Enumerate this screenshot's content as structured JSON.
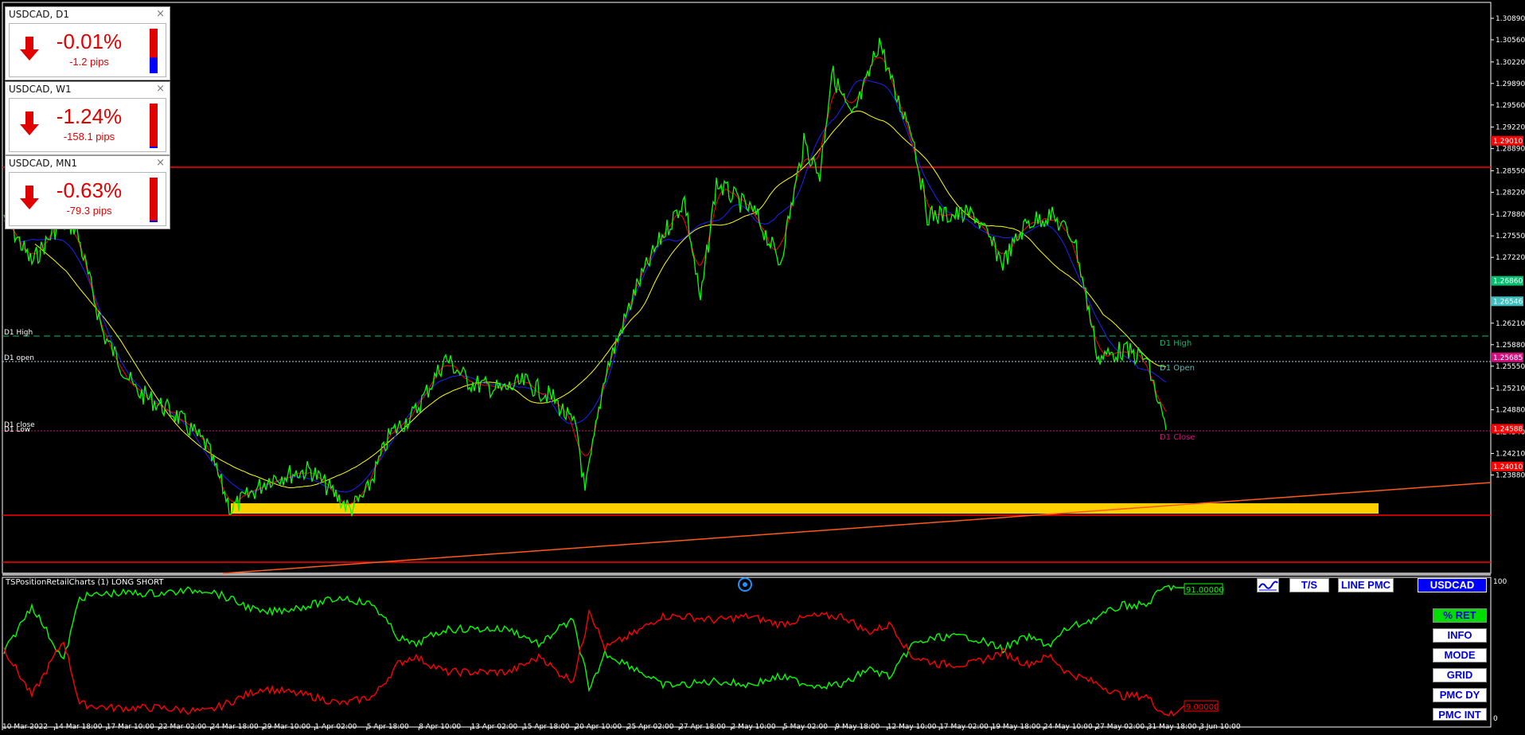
{
  "symbol_panels": [
    {
      "title": "USDCAD, D1",
      "percent": "-0.01%",
      "pips": "-1.2 pips",
      "direction": "down",
      "level": 0.35,
      "level_color": "#0000ff"
    },
    {
      "title": "USDCAD, W1",
      "percent": "-1.24%",
      "pips": "-158.1 pips",
      "direction": "down",
      "level": 0.0,
      "level_color": "#0000ff"
    },
    {
      "title": "USDCAD, MN1",
      "percent": "-0.63%",
      "pips": "-79.3 pips",
      "direction": "down",
      "level": 0.0,
      "level_color": "#0000ff"
    }
  ],
  "close_symbol": "×",
  "price_axis": {
    "ticks": [
      "1.30890",
      "1.30560",
      "1.30220",
      "1.29890",
      "1.29560",
      "1.29220",
      "1.28890",
      "1.28550",
      "1.28220",
      "1.27880",
      "1.27550",
      "1.27220",
      "1.26210",
      "1.25880",
      "1.25550",
      "1.25210",
      "1.24880",
      "1.24540",
      "1.24210",
      "1.23880"
    ],
    "highlighted": [
      {
        "label": "1.29010",
        "color": "#ff0000"
      },
      {
        "label": "1.26860",
        "color": "#00c070"
      },
      {
        "label": "1.26546",
        "color": "#40c0c0"
      },
      {
        "label": "1.25685",
        "color": "#d01080"
      },
      {
        "label": "1.24588",
        "color": "#ff0000"
      },
      {
        "label": "1.24010",
        "color": "#ff0000"
      }
    ]
  },
  "line_labels_left": {
    "d1_high": "D1 High",
    "d1_open": "D1 open",
    "d1_close": "D1 close",
    "d1_low": "D1 Low"
  },
  "line_labels_right": {
    "d1_high": "D1 High",
    "d1_open": "D1 Open",
    "d1_close": "D1 Close"
  },
  "time_axis": [
    "10 Mar 2022",
    "14 Mar 18:00",
    "17 Mar 10:00",
    "22 Mar 02:00",
    "24 Mar 18:00",
    "29 Mar 10:00",
    "1 Apr 02:00",
    "5 Apr 18:00",
    "8 Apr 10:00",
    "13 Apr 02:00",
    "15 Apr 18:00",
    "20 Apr 10:00",
    "25 Apr 02:00",
    "27 Apr 18:00",
    "2 May 10:00",
    "5 May 02:00",
    "9 May 18:00",
    "12 May 10:00",
    "17 May 02:00",
    "19 May 18:00",
    "24 May 10:00",
    "27 May 02:00",
    "31 May 18:00",
    "3 Jun 10:00"
  ],
  "indicator": {
    "title": "TSPositionRetailCharts (1) LONG SHORT",
    "scale_top": "100",
    "scale_bottom": "0",
    "long_value": "91.00000",
    "short_value": "9.00000"
  },
  "buttons": {
    "tsi": "T/S",
    "line_pmc": "LINE PMC",
    "symbol": "USDCAD",
    "ret": "% RET",
    "info": "INFO",
    "mode": "MODE",
    "grid": "GRID",
    "pmc_dy": "PMC DY",
    "pmc_int": "PMC INT"
  },
  "colors": {
    "price": "#00ff00",
    "ma_fast": "#ff0000",
    "ma_mid": "#0000ff",
    "ma_slow": "#ffff00",
    "resistance": "#ff0000",
    "support_zone": "#ffd000",
    "trendline": "#ff5a1a",
    "long_line": "#00ff00",
    "short_line": "#ff0000"
  }
}
